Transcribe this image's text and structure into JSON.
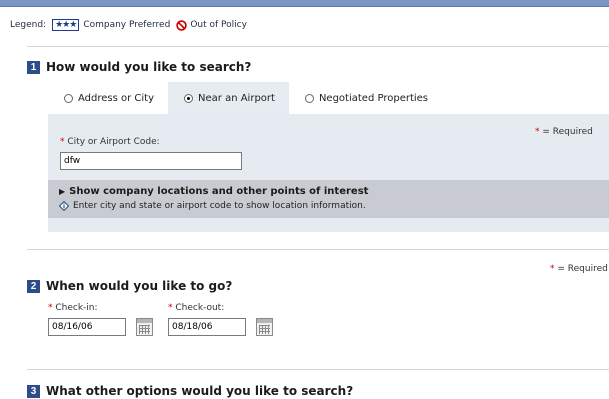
{
  "legend": {
    "label": "Legend:",
    "stars": "★★★",
    "company_preferred": "Company Preferred",
    "out_of_policy": "Out of Policy"
  },
  "section1": {
    "number": "1",
    "title": "How would you like to search?",
    "tabs": [
      {
        "label": "Address or City",
        "selected": false
      },
      {
        "label": "Near an Airport",
        "selected": true
      },
      {
        "label": "Negotiated Properties",
        "selected": false
      }
    ],
    "required_asterisk": "*",
    "required_text": " = Required",
    "city_field": {
      "asterisk": "* ",
      "label": "City or Airport Code:",
      "value": "dfw"
    },
    "locations_link": "Show company locations and other points of interest",
    "locations_hint": "Enter city and state or airport code to show location information."
  },
  "section2": {
    "number": "2",
    "title": "When would you like to go?",
    "required_asterisk": "*",
    "required_text": " = Required",
    "checkin": {
      "asterisk": "* ",
      "label": "Check-in:",
      "value": "08/16/06"
    },
    "checkout": {
      "asterisk": "* ",
      "label": "Check-out:",
      "value": "08/18/06"
    }
  },
  "section3": {
    "number": "3",
    "title": "What other options would you like to search?"
  },
  "colors": {
    "section_badge": "#2d4c8a",
    "panel_bg": "#e6ebf1",
    "location_bar": "#c8ccd2",
    "required_asterisk": "#cc0000",
    "out_of_policy_icon": "#cc0000"
  }
}
